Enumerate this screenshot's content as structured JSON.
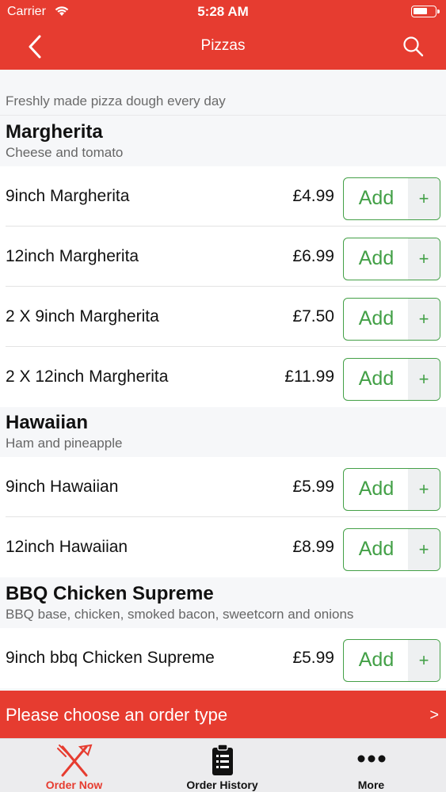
{
  "status_bar": {
    "carrier": "Carrier",
    "time": "5:28 AM"
  },
  "nav": {
    "title": "Pizzas",
    "back_icon": "chevron-left-icon",
    "search_icon": "search-icon"
  },
  "intro": "Freshly made pizza dough every day",
  "add_label": "Add",
  "plus_label": "+",
  "categories": [
    {
      "title": "Margherita",
      "description": "Cheese and tomato",
      "items": [
        {
          "name": "9inch Margherita",
          "price": "£4.99"
        },
        {
          "name": "12inch Margherita",
          "price": "£6.99"
        },
        {
          "name": "2 X 9inch Margherita",
          "price": "£7.50"
        },
        {
          "name": "2 X 12inch Margherita",
          "price": "£11.99"
        }
      ]
    },
    {
      "title": "Hawaiian",
      "description": "Ham and pineapple",
      "items": [
        {
          "name": "9inch Hawaiian",
          "price": "£5.99"
        },
        {
          "name": "12inch Hawaiian",
          "price": "£8.99"
        }
      ]
    },
    {
      "title": "BBQ Chicken Supreme",
      "description": "BBQ base, chicken, smoked bacon, sweetcorn and onions",
      "items": [
        {
          "name": "9inch bbq Chicken Supreme",
          "price": "£5.99"
        }
      ]
    }
  ],
  "order_bar": {
    "text": "Please choose an order type",
    "chevron": ">"
  },
  "tabs": [
    {
      "label": "Order Now",
      "icon": "fork-knife-icon",
      "active": true
    },
    {
      "label": "Order History",
      "icon": "clipboard-list-icon",
      "active": false
    },
    {
      "label": "More",
      "icon": "more-dots-icon",
      "active": false
    }
  ],
  "colors": {
    "brand_red": "#e63c30",
    "add_green": "#43a047"
  }
}
